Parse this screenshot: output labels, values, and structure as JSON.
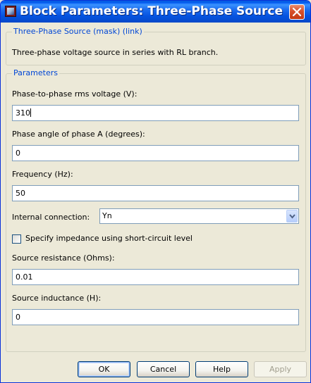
{
  "window": {
    "title": "Block Parameters: Three-Phase Source"
  },
  "mask_group": {
    "legend": "Three-Phase Source (mask) (link)",
    "description": "Three-phase voltage source in series with RL branch."
  },
  "params_group": {
    "legend": "Parameters",
    "fields": [
      {
        "label": "Phase-to-phase rms voltage (V):",
        "value": "310"
      },
      {
        "label": "Phase angle of phase A (degrees):",
        "value": "0"
      },
      {
        "label": "Frequency (Hz):",
        "value": "50"
      },
      {
        "label": "Source resistance (Ohms):",
        "value": "0.01"
      },
      {
        "label": "Source inductance (H):",
        "value": "0"
      }
    ],
    "internal_connection": {
      "label": "Internal connection:",
      "value": "Yn"
    },
    "impedance_checkbox": {
      "label": "Specify impedance using short-circuit level",
      "checked": false
    }
  },
  "buttons": {
    "ok": "OK",
    "cancel": "Cancel",
    "help": "Help",
    "apply": "Apply"
  },
  "icons": {
    "app": "simulink-block-icon",
    "close": "close-icon",
    "dropdown": "chevron-down-icon"
  },
  "colors": {
    "titlebar": "#0553e0",
    "legend_text": "#0046d5",
    "dialog_bg": "#ece9d8"
  }
}
